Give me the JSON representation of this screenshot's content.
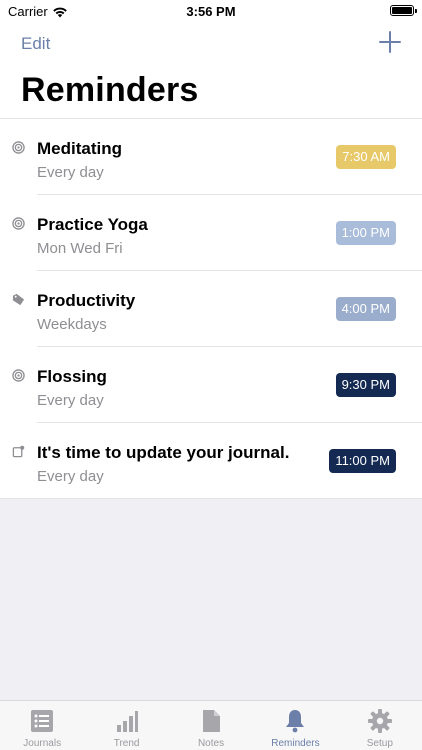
{
  "status_bar": {
    "carrier": "Carrier",
    "time": "3:56 PM"
  },
  "nav": {
    "edit_label": "Edit"
  },
  "page": {
    "title": "Reminders"
  },
  "reminders": [
    {
      "title": "Meditating",
      "subtitle": "Every day",
      "time": "7:30 AM",
      "icon": "target-icon",
      "badge_color": "#e8c96a"
    },
    {
      "title": "Practice Yoga",
      "subtitle": "Mon Wed Fri",
      "time": "1:00 PM",
      "icon": "target-icon",
      "badge_color": "#a9bcd9"
    },
    {
      "title": "Productivity",
      "subtitle": "Weekdays",
      "time": "4:00 PM",
      "icon": "tag-icon",
      "badge_color": "#9aadcc"
    },
    {
      "title": "Flossing",
      "subtitle": "Every day",
      "time": "9:30 PM",
      "icon": "target-icon",
      "badge_color": "#142a52"
    },
    {
      "title": "It's time to update your journal.",
      "subtitle": "Every day",
      "time": "11:00 PM",
      "icon": "journal-note-icon",
      "badge_color": "#142a52"
    }
  ],
  "tabs": [
    {
      "label": "Journals",
      "icon": "journals-list-icon"
    },
    {
      "label": "Trend",
      "icon": "bar-chart-icon"
    },
    {
      "label": "Notes",
      "icon": "document-icon"
    },
    {
      "label": "Reminders",
      "icon": "bell-icon",
      "active": true
    },
    {
      "label": "Setup",
      "icon": "gear-icon"
    }
  ],
  "colors": {
    "accent": "#6b7fa8",
    "inactive": "#9a9aa0"
  }
}
